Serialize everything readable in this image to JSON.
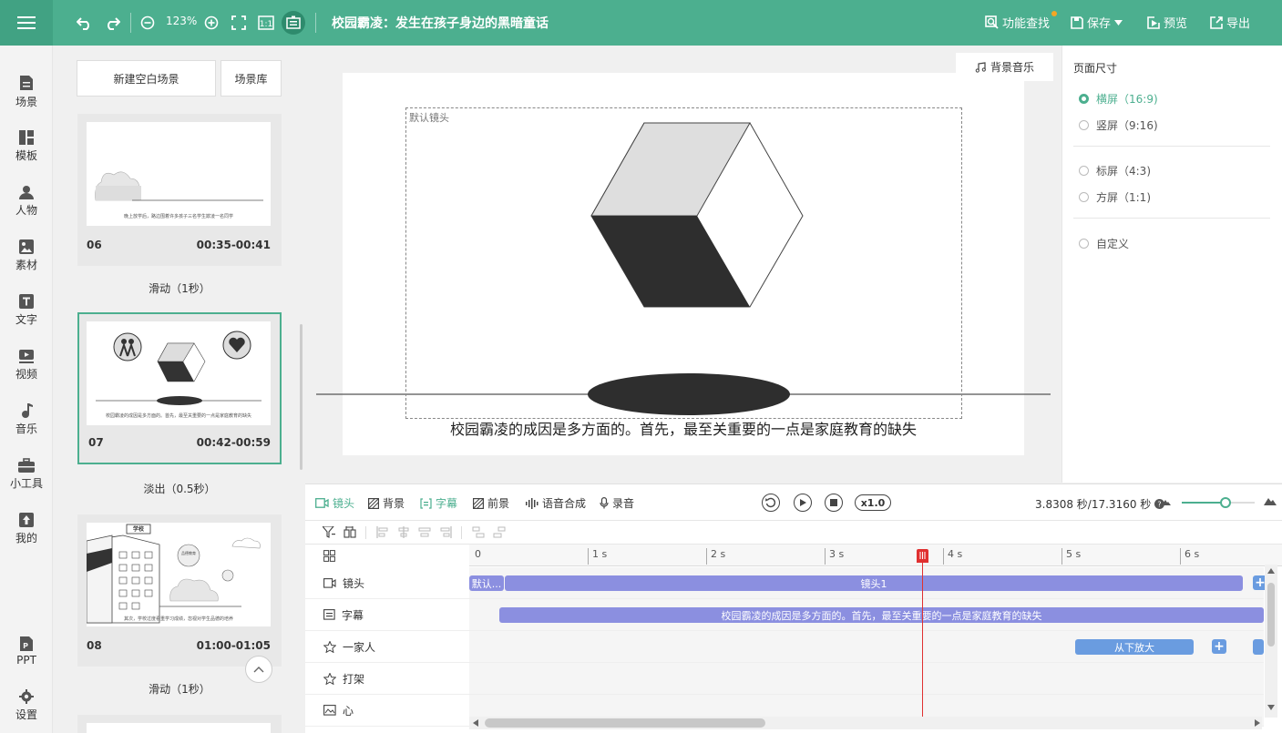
{
  "toolbar": {
    "zoom": "123%",
    "title": "校园霸凌：发生在孩子身边的黑暗童话",
    "feature_search": "功能查找",
    "save": "保存",
    "preview": "预览",
    "export": "导出",
    "accent": "#4caf8f"
  },
  "sidebar": {
    "items": [
      {
        "label": "场景",
        "icon": "scene-icon"
      },
      {
        "label": "模板",
        "icon": "template-icon"
      },
      {
        "label": "人物",
        "icon": "person-icon"
      },
      {
        "label": "素材",
        "icon": "material-icon"
      },
      {
        "label": "文字",
        "icon": "text-icon"
      },
      {
        "label": "视频",
        "icon": "video-icon"
      },
      {
        "label": "音乐",
        "icon": "music-icon"
      },
      {
        "label": "小工具",
        "icon": "toolbox-icon"
      },
      {
        "label": "我的",
        "icon": "upload-icon"
      },
      {
        "label": "PPT",
        "icon": "ppt-icon"
      },
      {
        "label": "设置",
        "icon": "gear-icon"
      }
    ]
  },
  "scenes": {
    "new_blank": "新建空白场景",
    "library": "场景库",
    "cards": [
      {
        "num": "06",
        "time": "00:35-00:41",
        "caption": "晚上放学后，路边围着许多孩子三名学生欺凌一名同学",
        "transition": "滑动（1秒）"
      },
      {
        "num": "07",
        "time": "00:42-00:59",
        "caption": "校园霸凌的成因是多方面的。首先，最至关重要的一点是家庭教育的缺失",
        "transition": "淡出（0.5秒）"
      },
      {
        "num": "08",
        "time": "01:00-01:05",
        "caption": "其次，学校过度看重学习成绩，忽视对学生品德的培养",
        "transition": "滑动（1秒）",
        "sign": "学校",
        "bubble": "品德教育"
      }
    ]
  },
  "stage": {
    "camera_label": "默认镜头",
    "subtitle": "校园霸凌的成因是多方面的。首先，最至关重要的一点是家庭教育的缺失",
    "music_button": "背景音乐"
  },
  "page_size": {
    "title": "页面尺寸",
    "options": [
      {
        "label": "横屏（16:9)",
        "selected": true
      },
      {
        "label": "竖屏（9:16)",
        "selected": false
      },
      {
        "label": "标屏（4:3)",
        "selected": false
      },
      {
        "label": "方屏（1:1)",
        "selected": false
      },
      {
        "label": "自定义",
        "selected": false
      }
    ]
  },
  "timeline": {
    "tabs": [
      "镜头",
      "背景",
      "字幕",
      "前景",
      "语音合成",
      "录音"
    ],
    "active_tab": "字幕",
    "speed": "x1.0",
    "time": "3.8308 秒/17.3160 秒",
    "ruler": [
      "0",
      "1 s",
      "2 s",
      "3 s",
      "4 s",
      "5 s",
      "6 s"
    ],
    "zoom_level": 0.6,
    "playhead_seconds": 3.83,
    "tracks": [
      {
        "label": "镜头",
        "icon": "camera-icon"
      },
      {
        "label": "字幕",
        "icon": "subtitle-icon"
      },
      {
        "label": "一家人",
        "icon": "star-icon"
      },
      {
        "label": "打架",
        "icon": "star-icon"
      },
      {
        "label": "心",
        "icon": "image-icon"
      }
    ],
    "clips": {
      "camera_default": "默认...",
      "camera_1": "镜头1",
      "subtitle": "校园霸凌的成因是多方面的。首先，最至关重要的一点是家庭教育的缺失",
      "family_anim": "从下放大",
      "add": "+"
    }
  }
}
